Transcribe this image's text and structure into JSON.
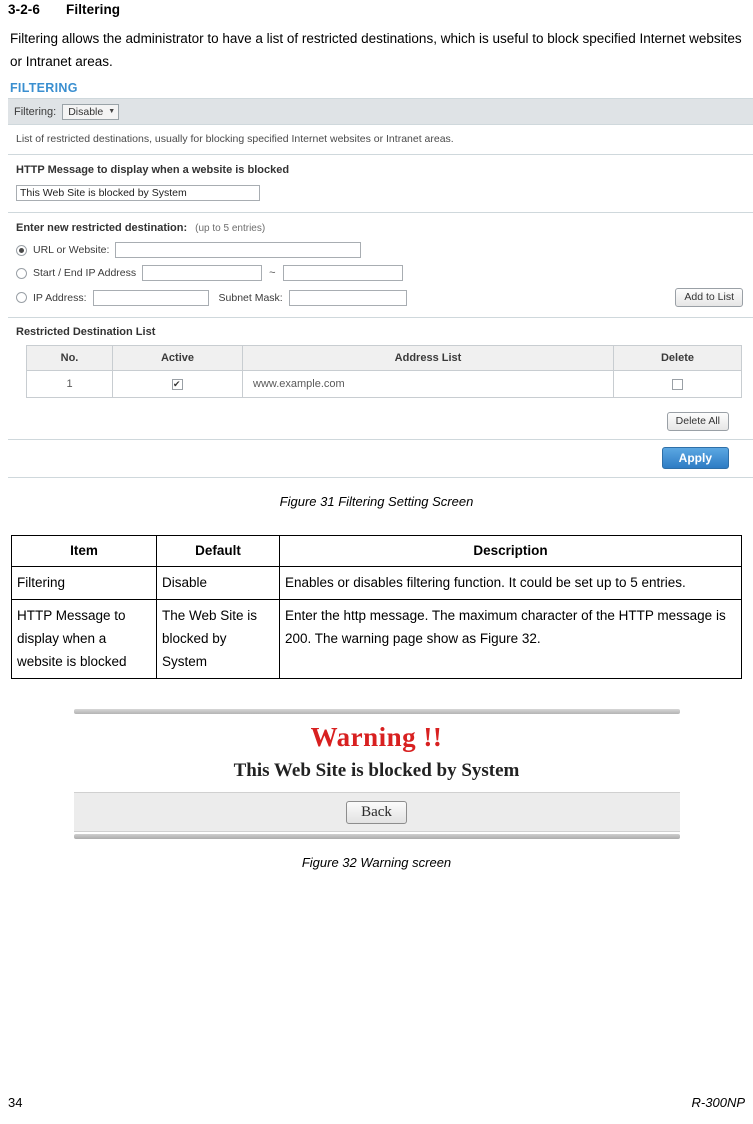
{
  "heading": {
    "number": "3-2-6",
    "title": "Filtering"
  },
  "intro": "Filtering allows the administrator to have a list of restricted destinations, which is useful to block specified Internet websites or Intranet areas.",
  "screenshot": {
    "panel_title": "FILTERING",
    "filtering_label": "Filtering:",
    "filtering_value": "Disable",
    "description": "List of restricted destinations, usually for blocking specified Internet websites or Intranet areas.",
    "http_message_title": "HTTP Message to display when a website is blocked",
    "http_message_value": "This Web Site is blocked by System",
    "enter_new_title": "Enter new restricted destination:",
    "enter_new_hint": "(up to 5 entries)",
    "option_url_label": "URL or Website:",
    "option_url_value": "",
    "option_startend_label": "Start / End IP Address",
    "option_start_value": "",
    "option_end_value": "",
    "tilde": "~",
    "option_ip_label": "IP Address:",
    "option_ip_value": "",
    "subnet_label": "Subnet Mask:",
    "subnet_value": "",
    "add_to_list_label": "Add to List",
    "restricted_list_title": "Restricted Destination List",
    "table": {
      "headers": [
        "No.",
        "Active",
        "Address List",
        "Delete"
      ],
      "rows": [
        {
          "no": "1",
          "active_checked": true,
          "address": "www.example.com",
          "delete_checked": false
        }
      ]
    },
    "delete_all_label": "Delete All",
    "apply_label": "Apply"
  },
  "figure31_caption": "Figure 31 Filtering Setting Screen",
  "items_table": {
    "headers": [
      "Item",
      "Default",
      "Description"
    ],
    "rows": [
      {
        "item": "Filtering",
        "default": "Disable",
        "description": "Enables or disables filtering function. It could be set up to 5 entries."
      },
      {
        "item": "HTTP Message to display when a website is blocked",
        "default": "The Web Site is blocked by System",
        "description": "Enter the http message. The maximum character of the HTTP message is 200. The warning page show as Figure 32."
      }
    ]
  },
  "warning_screen": {
    "title": "Warning !!",
    "subtitle": "This Web Site is blocked by System",
    "back_label": "Back"
  },
  "figure32_caption": "Figure 32 Warning screen",
  "footer": {
    "page_number": "34",
    "model": "R-300NP"
  }
}
